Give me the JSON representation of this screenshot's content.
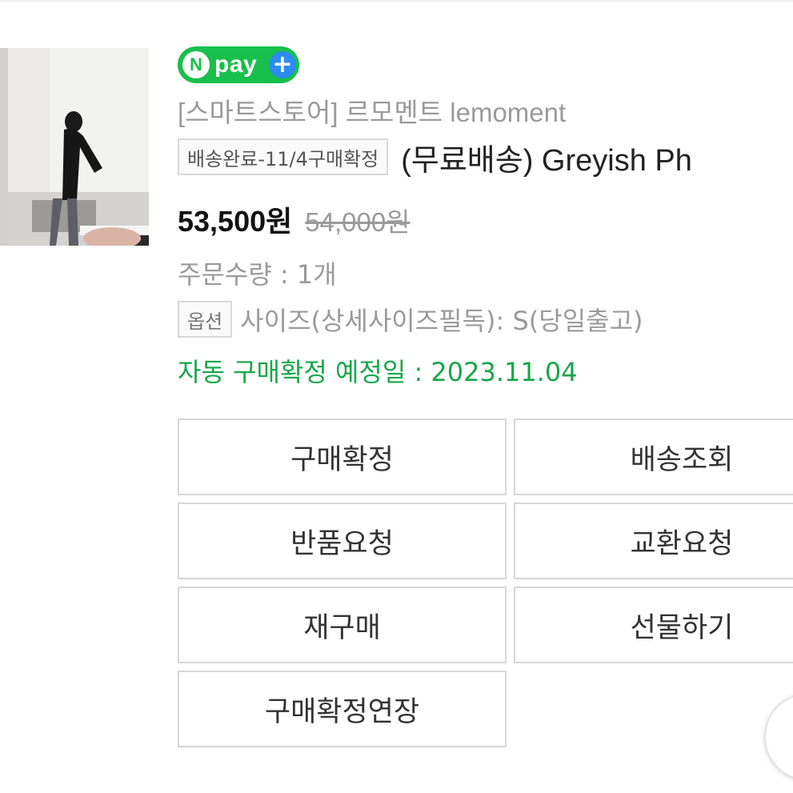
{
  "badge": {
    "n_letter": "N",
    "text": "pay",
    "plus": "+",
    "color": "#17c04b",
    "plus_color": "#2d8cf0"
  },
  "product": {
    "image_icon": "product-photo",
    "store": "[스마트스토어] 르모멘트 lemoment",
    "status_tag": "배송완료-11/4구매확정",
    "title": "(무료배송) Greyish Ph",
    "price": "53,500원",
    "original_price": "54,000원",
    "quantity": "주문수량 : 1개",
    "option_label": "옵션",
    "option_value": "사이즈(상세사이즈필독): S(당일출고)",
    "auto_confirm": "자동 구매확정 예정일 : 2023.11.04",
    "auto_confirm_color": "#17a74a"
  },
  "actions": {
    "confirm_purchase": "구매확정",
    "track_delivery": "배송조회",
    "return_request": "반품요청",
    "exchange_request": "교환요청",
    "repurchase": "재구매",
    "gift": "선물하기",
    "extend_confirm": "구매확정연장"
  }
}
